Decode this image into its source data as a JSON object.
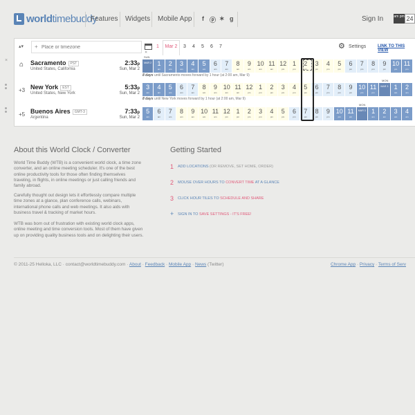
{
  "header": {
    "logo_world": "world",
    "logo_rest": "timebuddy",
    "nav": [
      "Features",
      "Widgets",
      "Mobile App"
    ],
    "social": [
      "f",
      "ⓟ",
      "✶",
      "g"
    ],
    "signin": "Sign In",
    "ampm_label": "am pm",
    "h24_label": "24"
  },
  "toolbar": {
    "arrows": "▴▾",
    "search_placeholder": "Place or timezone",
    "date_prev": "1",
    "date_selected": "Mar 2",
    "dates": [
      "3",
      "4",
      "5",
      "6",
      "7"
    ],
    "settings": "Settings",
    "link_view": "LINK TO THIS VIEW"
  },
  "rows": [
    {
      "city": "Sacramento",
      "abbr": "PST",
      "region": "United States, California",
      "time": "2:33",
      "time_suffix": "p",
      "date": "Sun, Mar 2",
      "offset": "",
      "day_label": "SUN",
      "dst_days": "8 days",
      "dst_text": "until Sacramento moves forward by 1 hour (at 2:00 am, Mar 9)",
      "hours": [
        {
          "v": "MAR 2",
          "s": "",
          "t": "dl"
        },
        {
          "v": "1",
          "s": "am",
          "t": "n"
        },
        {
          "v": "2",
          "s": "am",
          "t": "n"
        },
        {
          "v": "3",
          "s": "am",
          "t": "n"
        },
        {
          "v": "4",
          "s": "am",
          "t": "n"
        },
        {
          "v": "5",
          "s": "am",
          "t": "n"
        },
        {
          "v": "6",
          "s": "am",
          "t": "d"
        },
        {
          "v": "7",
          "s": "am",
          "t": "d"
        },
        {
          "v": "8",
          "s": "am",
          "t": "w"
        },
        {
          "v": "9",
          "s": "am",
          "t": "w"
        },
        {
          "v": "10",
          "s": "am",
          "t": "w"
        },
        {
          "v": "11",
          "s": "am",
          "t": "w"
        },
        {
          "v": "12",
          "s": "pm",
          "t": "w"
        },
        {
          "v": "1",
          "s": "pm",
          "t": "w"
        },
        {
          "v": "2",
          "s": "pm",
          "t": "w"
        },
        {
          "v": "3",
          "s": "pm",
          "t": "w"
        },
        {
          "v": "4",
          "s": "pm",
          "t": "w"
        },
        {
          "v": "5",
          "s": "pm",
          "t": "w"
        },
        {
          "v": "6",
          "s": "pm",
          "t": "d"
        },
        {
          "v": "7",
          "s": "pm",
          "t": "d"
        },
        {
          "v": "8",
          "s": "pm",
          "t": "d"
        },
        {
          "v": "9",
          "s": "pm",
          "t": "d"
        },
        {
          "v": "10",
          "s": "pm",
          "t": "n"
        },
        {
          "v": "11",
          "s": "pm",
          "t": "n"
        }
      ]
    },
    {
      "city": "New York",
      "abbr": "EST",
      "region": "United States, New York",
      "time": "5:33",
      "time_suffix": "p",
      "date": "Sun, Mar 2",
      "offset": "+3",
      "day_label": "MON",
      "dst_days": "8 days",
      "dst_text": "until New York moves forward by 1 hour (at 2:00 am, Mar 9)",
      "hours": [
        {
          "v": "3",
          "s": "am",
          "t": "n"
        },
        {
          "v": "4",
          "s": "am",
          "t": "n"
        },
        {
          "v": "5",
          "s": "am",
          "t": "n"
        },
        {
          "v": "6",
          "s": "am",
          "t": "d"
        },
        {
          "v": "7",
          "s": "am",
          "t": "d"
        },
        {
          "v": "8",
          "s": "am",
          "t": "w"
        },
        {
          "v": "9",
          "s": "am",
          "t": "w"
        },
        {
          "v": "10",
          "s": "am",
          "t": "w"
        },
        {
          "v": "11",
          "s": "am",
          "t": "w"
        },
        {
          "v": "12",
          "s": "pm",
          "t": "w"
        },
        {
          "v": "1",
          "s": "pm",
          "t": "w"
        },
        {
          "v": "2",
          "s": "pm",
          "t": "w"
        },
        {
          "v": "3",
          "s": "pm",
          "t": "w"
        },
        {
          "v": "4",
          "s": "pm",
          "t": "w"
        },
        {
          "v": "5",
          "s": "pm",
          "t": "w"
        },
        {
          "v": "6",
          "s": "pm",
          "t": "d"
        },
        {
          "v": "7",
          "s": "pm",
          "t": "d"
        },
        {
          "v": "8",
          "s": "pm",
          "t": "d"
        },
        {
          "v": "9",
          "s": "pm",
          "t": "d"
        },
        {
          "v": "10",
          "s": "pm",
          "t": "n"
        },
        {
          "v": "11",
          "s": "pm",
          "t": "n"
        },
        {
          "v": "MAR 3",
          "s": "",
          "t": "dl"
        },
        {
          "v": "1",
          "s": "am",
          "t": "n"
        },
        {
          "v": "2",
          "s": "am",
          "t": "n"
        }
      ]
    },
    {
      "city": "Buenos Aires",
      "abbr": "GMT-3",
      "region": "Argentina",
      "time": "7:33",
      "time_suffix": "p",
      "date": "Sun, Mar 2",
      "offset": "+5",
      "day_label": "MON",
      "dst_days": "",
      "dst_text": "",
      "hours": [
        {
          "v": "5",
          "s": "am",
          "t": "n"
        },
        {
          "v": "6",
          "s": "am",
          "t": "d"
        },
        {
          "v": "7",
          "s": "am",
          "t": "d"
        },
        {
          "v": "8",
          "s": "am",
          "t": "w"
        },
        {
          "v": "9",
          "s": "am",
          "t": "w"
        },
        {
          "v": "10",
          "s": "am",
          "t": "w"
        },
        {
          "v": "11",
          "s": "am",
          "t": "w"
        },
        {
          "v": "12",
          "s": "pm",
          "t": "w"
        },
        {
          "v": "1",
          "s": "pm",
          "t": "w"
        },
        {
          "v": "2",
          "s": "pm",
          "t": "w"
        },
        {
          "v": "3",
          "s": "pm",
          "t": "w"
        },
        {
          "v": "4",
          "s": "pm",
          "t": "w"
        },
        {
          "v": "5",
          "s": "pm",
          "t": "w"
        },
        {
          "v": "6",
          "s": "pm",
          "t": "d"
        },
        {
          "v": "7",
          "s": "pm",
          "t": "d"
        },
        {
          "v": "8",
          "s": "pm",
          "t": "d"
        },
        {
          "v": "9",
          "s": "pm",
          "t": "d"
        },
        {
          "v": "10",
          "s": "pm",
          "t": "n"
        },
        {
          "v": "11",
          "s": "pm",
          "t": "n"
        },
        {
          "v": "MAR 3",
          "s": "",
          "t": "dl"
        },
        {
          "v": "1",
          "s": "am",
          "t": "n"
        },
        {
          "v": "2",
          "s": "am",
          "t": "n"
        },
        {
          "v": "3",
          "s": "am",
          "t": "n"
        },
        {
          "v": "4",
          "s": "am",
          "t": "n"
        }
      ]
    }
  ],
  "about": {
    "title": "About this World Clock / Converter",
    "p1": "World Time Buddy (WTB) is a convenient world clock, a time zone converter, and an online meeting scheduler. It's one of the best online productivity tools for those often finding themselves traveling, in flights, in online meetings or just calling friends and family abroad.",
    "p2": "Carefully thought out design lets it effortlessly compare multiple time zones at a glance, plan conference calls, webinars, international phone calls and web meetings. It also aids with business travel & tracking of market hours.",
    "p3": "WTB was born out of frustration with existing world clock apps, online meeting and time conversion tools. Most of them have given up on providing quality business tools and on delighting their users."
  },
  "getting_started": {
    "title": "Getting Started",
    "s1_a": "ADD LOCATIONS",
    "s1_b": "(OR REMOVE, SET HOME, ORDER)",
    "s2_a": "MOUSE OVER HOURS TO",
    "s2_b": "CONVERT TIME",
    "s2_c": "AT A GLANCE",
    "s3_a": "CLICK HOUR TILES TO",
    "s3_b": "SCHEDULE AND SHARE",
    "s4_a": "SIGN IN TO",
    "s4_b": "SAVE SETTINGS",
    "s4_c": "- IT'S FREE!",
    "nums": [
      "1",
      "2",
      "3",
      "+"
    ]
  },
  "footer": {
    "copyright": "© 2011-25 Helloka, LLC",
    "email": "contact@worldtimebuddy.com",
    "about": "About",
    "feedback": "Feedback",
    "mobile": "Mobile App",
    "news": "News",
    "twitter": "(Twitter)",
    "chrome": "Chrome App",
    "privacy": "Privacy",
    "terms": "Terms of Serv"
  },
  "colors": {
    "accent": "#5a84b6",
    "pink": "#e05a7a",
    "night": "#7b9cc9",
    "day": "#e2eef9",
    "work": "#fffde8"
  }
}
